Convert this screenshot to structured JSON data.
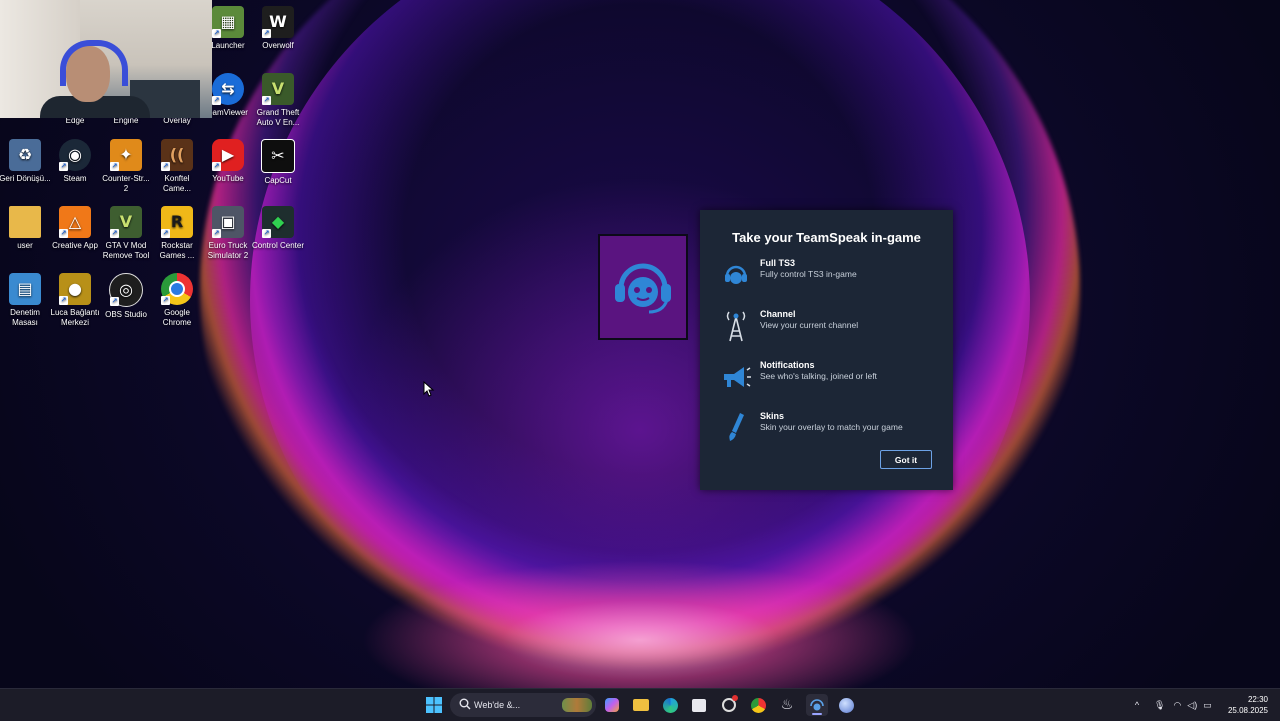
{
  "desktop": {
    "icons": [
      {
        "label": "Launcher",
        "glyph": "▦",
        "bg": "#5b8a3a"
      },
      {
        "label": "Overwolf",
        "glyph": "🐺",
        "bg": "#2a2a2a"
      },
      {
        "label": "eamViewer",
        "glyph": "⇆",
        "bg": "#1a6cd8"
      },
      {
        "label": "Grand Theft Auto V En...",
        "glyph": "V",
        "bg": "#3a5a2a"
      },
      {
        "label": "Edge",
        "glyph": "",
        "bg": "transparent"
      },
      {
        "label": "Engine",
        "glyph": "",
        "bg": "transparent"
      },
      {
        "label": "Overlay",
        "glyph": "",
        "bg": "transparent"
      },
      {
        "label": "Geri Dönüşü...",
        "glyph": "♻",
        "bg": "#5a7ca8"
      },
      {
        "label": "Steam",
        "glyph": "◉",
        "bg": "#1b2838"
      },
      {
        "label": "Counter-Str... 2",
        "glyph": "✦",
        "bg": "#e08a1a"
      },
      {
        "label": "Konftel Came...",
        "glyph": "((",
        "bg": "#6a3a1a"
      },
      {
        "label": "YouTube",
        "glyph": "▶",
        "bg": "#e02020"
      },
      {
        "label": "CapCut",
        "glyph": "✂",
        "bg": "#111111"
      },
      {
        "label": "user",
        "glyph": "▬",
        "bg": "#e8b84a"
      },
      {
        "label": "Creative App",
        "glyph": "△",
        "bg": "#f07818"
      },
      {
        "label": "GTA V Mod Remove Tool",
        "glyph": "V",
        "bg": "#4a6a3a"
      },
      {
        "label": "Rockstar Games ...",
        "glyph": "R",
        "bg": "#f0b818"
      },
      {
        "label": "Euro Truck Simulator 2",
        "glyph": "▣",
        "bg": "#5a6070"
      },
      {
        "label": "Control Center",
        "glyph": "◆",
        "bg": "#2a3a3a"
      },
      {
        "label": "Denetim Masası",
        "glyph": "▤",
        "bg": "#3a8ad0"
      },
      {
        "label": "Luca Bağlantı Merkezi",
        "glyph": "●",
        "bg": "#c8a020"
      },
      {
        "label": "OBS Studio",
        "glyph": "◎",
        "bg": "#222222"
      },
      {
        "label": "Google Chrome",
        "glyph": "◕",
        "bg": "#2a8a3a"
      }
    ]
  },
  "teamspeak": {
    "title": "Take your TeamSpeak in-game",
    "items": [
      {
        "head": "Full TS3",
        "sub": "Fully control TS3 in-game"
      },
      {
        "head": "Channel",
        "sub": "View your current channel"
      },
      {
        "head": "Notifications",
        "sub": "See who's talking, joined or left"
      },
      {
        "head": "Skins",
        "sub": "Skin your overlay to match your game"
      }
    ],
    "button": "Got it",
    "accent": "#2f86d6",
    "panel_bg": "#1c2636"
  },
  "taskbar": {
    "search_placeholder": "Web'de &...",
    "time": "22:30",
    "date": "25.08.2025"
  }
}
